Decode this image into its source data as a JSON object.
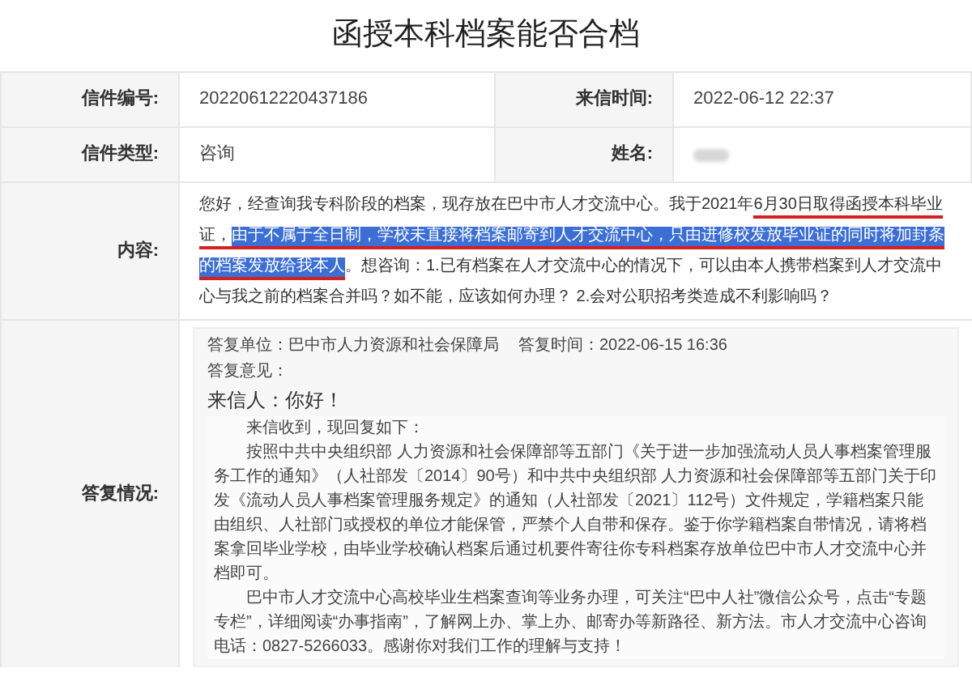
{
  "title": "函授本科档案能否合档",
  "fields": [
    {
      "label": "信件编号:",
      "value": "20220612220437186"
    },
    {
      "label": "来信时间:",
      "value": "2022-06-12 22:37"
    },
    {
      "label": "信件类型:",
      "value": "咨询"
    },
    {
      "label": "姓名:",
      "blurred": true
    }
  ],
  "content": {
    "label": "内容:",
    "segments": [
      {
        "text": "您好，经查询我专科阶段的档案，现存放在巴中市人才交流中心。我于2021年",
        "highlighted": false,
        "underlined": false
      },
      {
        "text": "6月30日取得函授本科毕业证，",
        "highlighted": false,
        "underlined": true
      },
      {
        "text": "由于不属于全日制，学校未直接将档案邮寄到人才交流中心，只由进修校发放毕业证的同时将加封条的档案发放给我本人",
        "highlighted": true,
        "underlined": true
      },
      {
        "text": "。想咨询：1.已有档案在人才交流中心的情况下，可以由本人携带档案到人才交流中心与我之前的档案合并吗？如不能，应该如何办理？ 2.会对公职招考类造成不利影响吗？",
        "highlighted": false,
        "underlined": false
      }
    ]
  },
  "reply": {
    "label": "答复情况:",
    "unit_label": "答复单位：",
    "unit": "巴中市人力资源和社会保障局",
    "time_label": "答复时间：",
    "time": "2022-06-15 16:36",
    "opinion_label": "答复意见：",
    "greeting": "来信人：你好！",
    "paragraphs": [
      "来信收到，现回复如下：",
      "按照中共中央组织部 人力资源和社会保障部等五部门《关于进一步加强流动人员人事档案管理服务工作的通知》（人社部发〔2014〕90号）和中共中央组织部 人力资源和社会保障部等五部门关于印发《流动人员人事档案管理服务规定》的通知（人社部发〔2021〕112号）文件规定，学籍档案只能由组织、人社部门或授权的单位才能保管，严禁个人自带和保存。鉴于你学籍档案自带情况，请将档案拿回毕业学校，由毕业学校确认档案后通过机要件寄往你专科档案存放单位巴中市人才交流中心并档即可。",
      "巴中市人才交流中心高校毕业生档案查询等业务办理，可关注“巴中人社”微信公众号，点击“专题专栏”，详细阅读“办事指南”，了解网上办、掌上办、邮寄办等新路径、新方法。市人才交流中心咨询电话：0827-5266033。感谢你对我们工作的理解与支持！"
    ]
  }
}
